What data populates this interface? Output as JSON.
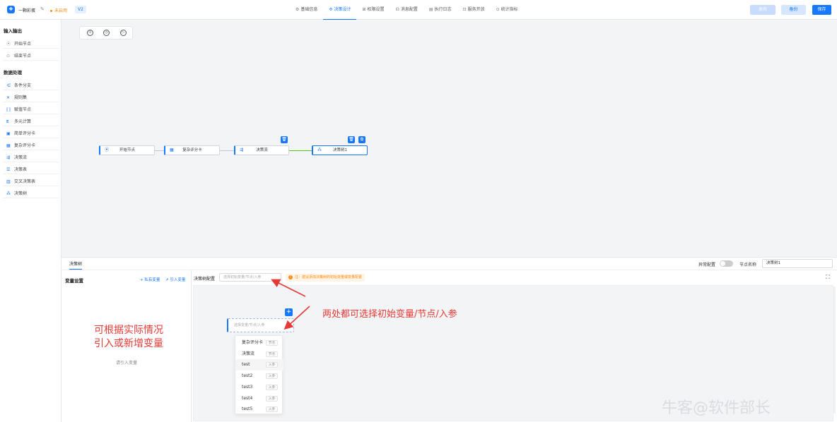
{
  "header": {
    "app_name": "一颗彩蛋",
    "status": "未启用",
    "version": "V2",
    "tabs": [
      {
        "icon": "⚙",
        "label": "基础信息"
      },
      {
        "icon": "✣",
        "label": "决策设计"
      },
      {
        "icon": "⊞",
        "label": "权限设置"
      },
      {
        "icon": "☊",
        "label": "消息配置"
      },
      {
        "icon": "▤",
        "label": "执行日志"
      },
      {
        "icon": "⊡",
        "label": "服务开放"
      },
      {
        "icon": "⊙",
        "label": "统计指标"
      }
    ],
    "publish_label": "发布",
    "backup_label": "备份",
    "save_label": "保存"
  },
  "sidebar": {
    "section_io": "输入输出",
    "io_items": [
      {
        "icon": "⦿",
        "label": "开始节点"
      },
      {
        "icon": "⊙",
        "label": "结束节点"
      }
    ],
    "section_data": "数据处理",
    "data_items": [
      {
        "icon": "⋲",
        "label": "条件分支"
      },
      {
        "icon": "✕",
        "label": "规则集"
      },
      {
        "icon": "⟦⟧",
        "label": "赋值节点"
      },
      {
        "icon": "⩩",
        "label": "多元计算"
      },
      {
        "icon": "▣",
        "label": "简单评分卡"
      },
      {
        "icon": "▦",
        "label": "复杂评分卡"
      },
      {
        "icon": "⇶",
        "label": "决策流"
      },
      {
        "icon": "☰",
        "label": "决策表"
      },
      {
        "icon": "▥",
        "label": "交叉决策表"
      },
      {
        "icon": "⁂",
        "label": "决策树"
      }
    ]
  },
  "canvas": {
    "tools": [
      "①",
      "◷",
      "▷"
    ],
    "nodes": [
      {
        "icon": "⦿",
        "label": "开始节点"
      },
      {
        "icon": "▦",
        "label": "复杂评分卡"
      },
      {
        "icon": "⇶",
        "label": "决策流"
      },
      {
        "icon": "⁂",
        "label": "决策树1"
      }
    ]
  },
  "bottom": {
    "tab": "决策树",
    "exception_label": "异常配置",
    "node_name_label": "节点名称",
    "node_name_value": "决策树1",
    "var_title": "变量设置",
    "private_var": "+ 私有变量",
    "import_var": "⇗ 引入变量",
    "empty_text": "请引入变量",
    "annotation_left": "可根据实际情况\n引入或新增变量",
    "config_label": "决策树配置",
    "config_placeholder": "选择初始变量/节点/入参",
    "warning": "注：建议添加决策树的初始变量或变量配置",
    "node_placeholder": "选择变量/节点/入参",
    "annotation_right": "两处都可选择初始变量/节点/入参",
    "dropdown": [
      {
        "label": "复杂评分卡",
        "tag": "节点"
      },
      {
        "label": "决策流",
        "tag": "节点"
      },
      {
        "label": "test",
        "tag": "入参"
      },
      {
        "label": "test2",
        "tag": "入参"
      },
      {
        "label": "test3",
        "tag": "入参"
      },
      {
        "label": "test4",
        "tag": "入参"
      },
      {
        "label": "test5",
        "tag": "入参"
      }
    ]
  },
  "watermark": "牛客@软件部长",
  "colors": {
    "accent": "#1677ff",
    "annotation": "#e53935",
    "warning": "#fa8c16",
    "edge_active": "#52c41a"
  }
}
